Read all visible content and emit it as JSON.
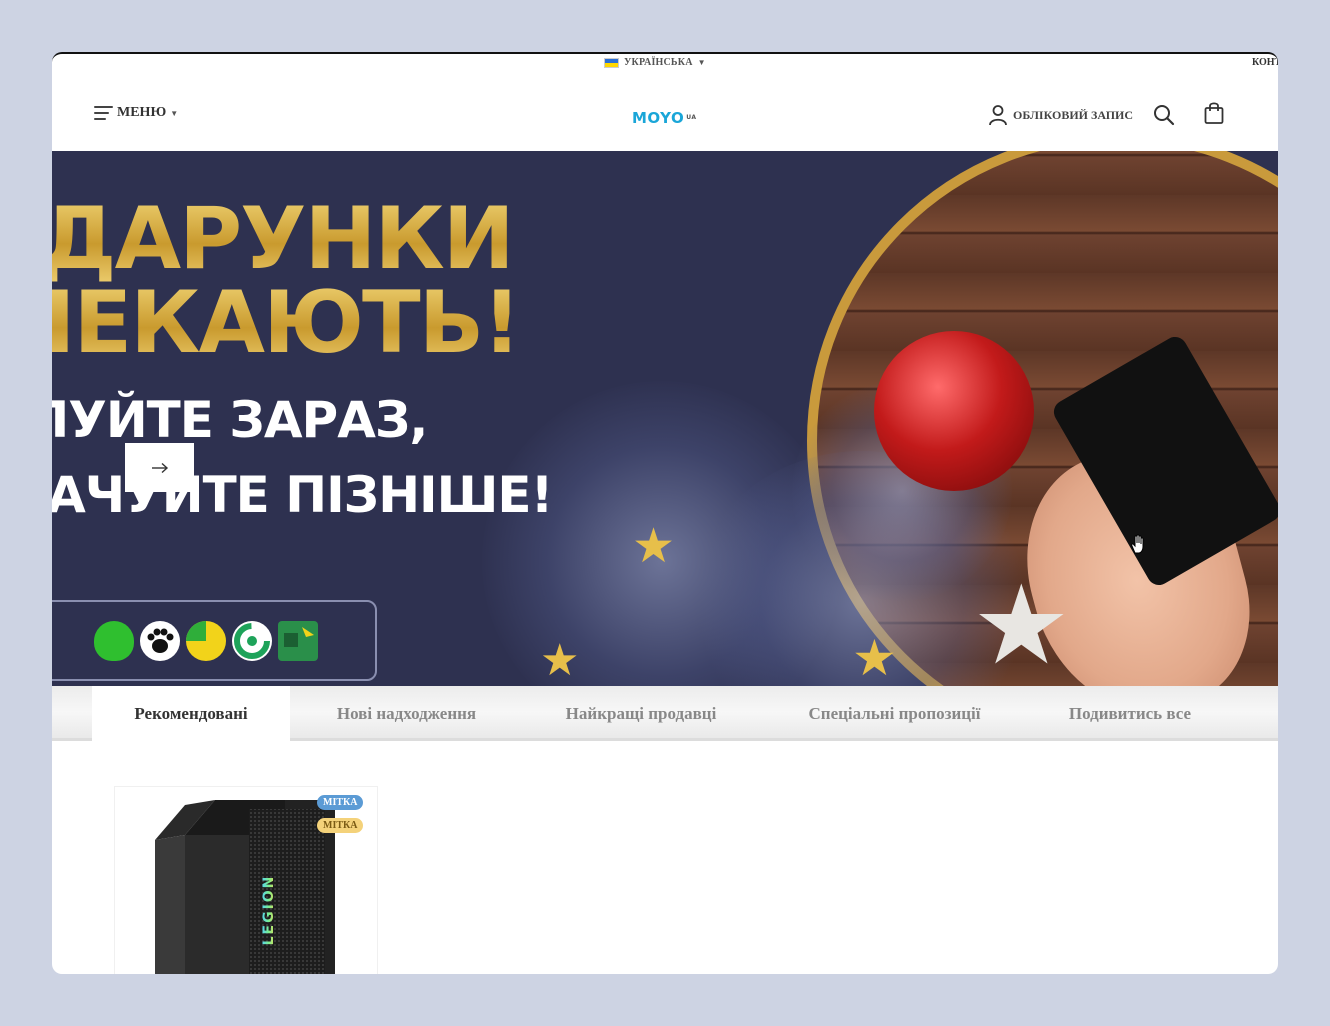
{
  "topbar": {
    "language_label": "УКРАЇНСЬКА",
    "contacts_label": "КОНТАКТИ"
  },
  "header": {
    "menu_label": "МЕНЮ",
    "logo_text": "MOYO",
    "logo_suffix": "UA",
    "account_label": "ОБЛІКОВИЙ ЗАПИС"
  },
  "banner": {
    "line1": "ДАРУНКИ",
    "line2": "ЧЕКАЮТЬ!",
    "line3": "КУПУЙТЕ ЗАРАЗ,",
    "line4": "СПЛАЧУЙТЕ ПІЗНІШЕ!",
    "colors": {
      "background": "#2e3150",
      "gold": "#d9b24a"
    }
  },
  "tabs": [
    {
      "label": "Рекомендовані",
      "active": true
    },
    {
      "label": "Нові надходження",
      "active": false
    },
    {
      "label": "Найкращі продавці",
      "active": false
    },
    {
      "label": "Спеціальні пропозиції",
      "active": false
    },
    {
      "label": "Подивитись все",
      "active": false
    }
  ],
  "product": {
    "badges": [
      "МІТКА",
      "МІТКА"
    ],
    "brand_text": "LEGION"
  }
}
